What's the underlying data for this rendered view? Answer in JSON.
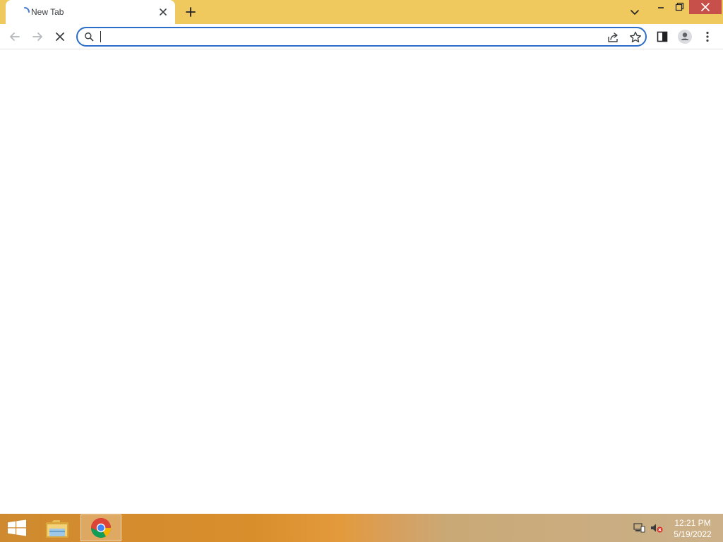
{
  "browser": {
    "tabs": [
      {
        "title": "New Tab",
        "loading": true,
        "active": true
      }
    ],
    "omnibox": {
      "value": "",
      "focused": true
    },
    "colors": {
      "frame": "#f0c95e",
      "focus_ring": "#2b6dc8",
      "close_button": "#c7504b"
    },
    "icons": {
      "tab_loading": "loading-spinner-icon",
      "tab_close": "close-icon",
      "new_tab": "plus-icon",
      "tab_search": "chevron-down-icon",
      "minimize": "minimize-icon",
      "restore": "restore-icon",
      "close": "close-icon",
      "back": "back-arrow-icon",
      "forward": "forward-arrow-icon",
      "stop": "stop-icon",
      "search": "search-icon",
      "share": "share-icon",
      "bookmark": "star-icon",
      "side_panel": "side-panel-icon",
      "profile": "profile-icon",
      "menu": "more-vert-icon"
    }
  },
  "taskbar": {
    "apps": [
      {
        "name": "File Explorer",
        "icon": "folder-icon",
        "active": false
      },
      {
        "name": "Google Chrome",
        "icon": "chrome-icon",
        "active": true
      }
    ],
    "tray_icons": [
      "network-icon",
      "volume-muted-icon"
    ],
    "clock": {
      "time": "12:21 PM",
      "date": "5/19/2022"
    }
  }
}
